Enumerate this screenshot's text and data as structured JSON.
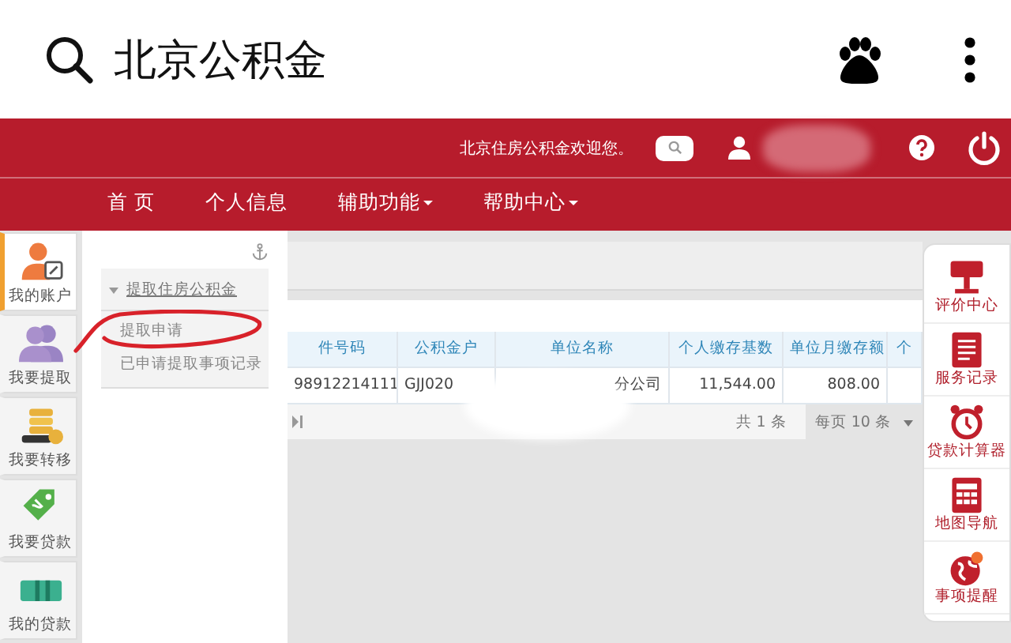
{
  "browser": {
    "query": "北京公积金"
  },
  "header": {
    "welcome": "北京住房公积金欢迎您。"
  },
  "nav": [
    {
      "label": "首 页",
      "dropdown": false
    },
    {
      "label": "个人信息",
      "dropdown": false
    },
    {
      "label": "辅助功能",
      "dropdown": true
    },
    {
      "label": "帮助中心",
      "dropdown": true
    }
  ],
  "left_menu": [
    {
      "label": "我的账户",
      "kind": "account",
      "selected": true
    },
    {
      "label": "我要提取",
      "kind": "withdraw",
      "selected": false
    },
    {
      "label": "我要转移",
      "kind": "transfer",
      "selected": false
    },
    {
      "label": "我要贷款",
      "kind": "loan",
      "selected": false
    },
    {
      "label": "我的贷款",
      "kind": "myloan",
      "selected": false
    }
  ],
  "submenu": {
    "title": "提取住房公积金",
    "expanded": true,
    "items": [
      "提取申请",
      "已申请提取事项记录"
    ]
  },
  "table": {
    "columns": [
      "件号码",
      "公积金户",
      "单位名称",
      "个人缴存基数",
      "单位月缴存额",
      "个"
    ],
    "rows": [
      [
        "98912214111",
        "GJJ020",
        "分公司",
        "11,544.00",
        "808.00",
        ""
      ]
    ],
    "footer": {
      "total": "共 1 条",
      "per_page": "每页 10 条"
    }
  },
  "tools": [
    {
      "label": "评价中心",
      "kind": "review"
    },
    {
      "label": "服务记录",
      "kind": "record"
    },
    {
      "label": "贷款计算器",
      "kind": "clock"
    },
    {
      "label": "地图导航",
      "kind": "calc"
    },
    {
      "label": "事项提醒",
      "kind": "globe"
    }
  ]
}
